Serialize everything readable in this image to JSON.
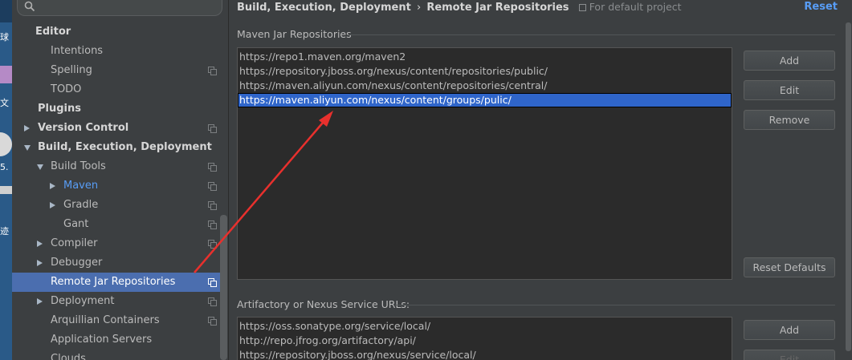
{
  "desktop_strip": {
    "chars": [
      "球",
      "文",
      "5.",
      "迹"
    ]
  },
  "search": {
    "placeholder": ""
  },
  "sidebar": {
    "items": [
      {
        "label": "Editor",
        "bold": true,
        "arrow": "",
        "level": 0,
        "copy": false
      },
      {
        "label": "Intentions",
        "bold": false,
        "arrow": "",
        "level": 2,
        "copy": false
      },
      {
        "label": "Spelling",
        "bold": false,
        "arrow": "",
        "level": 2,
        "copy": true
      },
      {
        "label": "TODO",
        "bold": false,
        "arrow": "",
        "level": 2,
        "copy": false
      },
      {
        "label": "Plugins",
        "bold": true,
        "arrow": "",
        "level": 0,
        "copy": false
      },
      {
        "label": "Version Control",
        "bold": true,
        "arrow": "right",
        "level": 0,
        "copy": true
      },
      {
        "label": "Build, Execution, Deployment",
        "bold": true,
        "arrow": "down",
        "level": 0,
        "copy": false
      },
      {
        "label": "Build Tools",
        "bold": false,
        "arrow": "down",
        "level": 1,
        "copy": true
      },
      {
        "label": "Maven",
        "bold": false,
        "arrow": "right",
        "level": 2,
        "copy": true,
        "blue": true
      },
      {
        "label": "Gradle",
        "bold": false,
        "arrow": "right",
        "level": 2,
        "copy": true
      },
      {
        "label": "Gant",
        "bold": false,
        "arrow": "",
        "level": 3,
        "copy": true
      },
      {
        "label": "Compiler",
        "bold": false,
        "arrow": "right",
        "level": 1,
        "copy": true
      },
      {
        "label": "Debugger",
        "bold": false,
        "arrow": "right",
        "level": 1,
        "copy": false
      },
      {
        "label": "Remote Jar Repositories",
        "bold": false,
        "arrow": "",
        "level": 2,
        "copy": true,
        "selected": true
      },
      {
        "label": "Deployment",
        "bold": false,
        "arrow": "right",
        "level": 1,
        "copy": true
      },
      {
        "label": "Arquillian Containers",
        "bold": false,
        "arrow": "",
        "level": 2,
        "copy": true
      },
      {
        "label": "Application Servers",
        "bold": false,
        "arrow": "",
        "level": 2,
        "copy": false
      },
      {
        "label": "Clouds",
        "bold": false,
        "arrow": "",
        "level": 2,
        "copy": false
      }
    ]
  },
  "header": {
    "crumb_parent": "Build, Execution, Deployment",
    "crumb_separator": "›",
    "crumb_current": "Remote Jar Repositories",
    "scope": "For default project",
    "reset_label": "Reset"
  },
  "maven": {
    "title": "Maven Jar Repositories",
    "urls": [
      "https://repo1.maven.org/maven2",
      "https://repository.jboss.org/nexus/content/repositories/public/",
      "https://maven.aliyun.com/nexus/content/repositories/central/",
      "https://maven.aliyun.com/nexus/content/groups/pulic/"
    ],
    "selected_index": 3,
    "buttons": {
      "add": "Add",
      "edit": "Edit",
      "remove": "Remove",
      "reset_defaults": "Reset Defaults"
    }
  },
  "artifactory": {
    "title": "Artifactory or Nexus Service URLs:",
    "urls": [
      "https://oss.sonatype.org/service/local/",
      "http://repo.jfrog.org/artifactory/api/",
      "https://repository.jboss.org/nexus/service/local/"
    ],
    "buttons": {
      "add": "Add",
      "edit": "Edit"
    }
  },
  "colors": {
    "background": "#3c3f41",
    "selection": "#4b6eaf",
    "list_selection": "#2f65ca",
    "link": "#589df6",
    "annotation_arrow": "#e8302d"
  }
}
